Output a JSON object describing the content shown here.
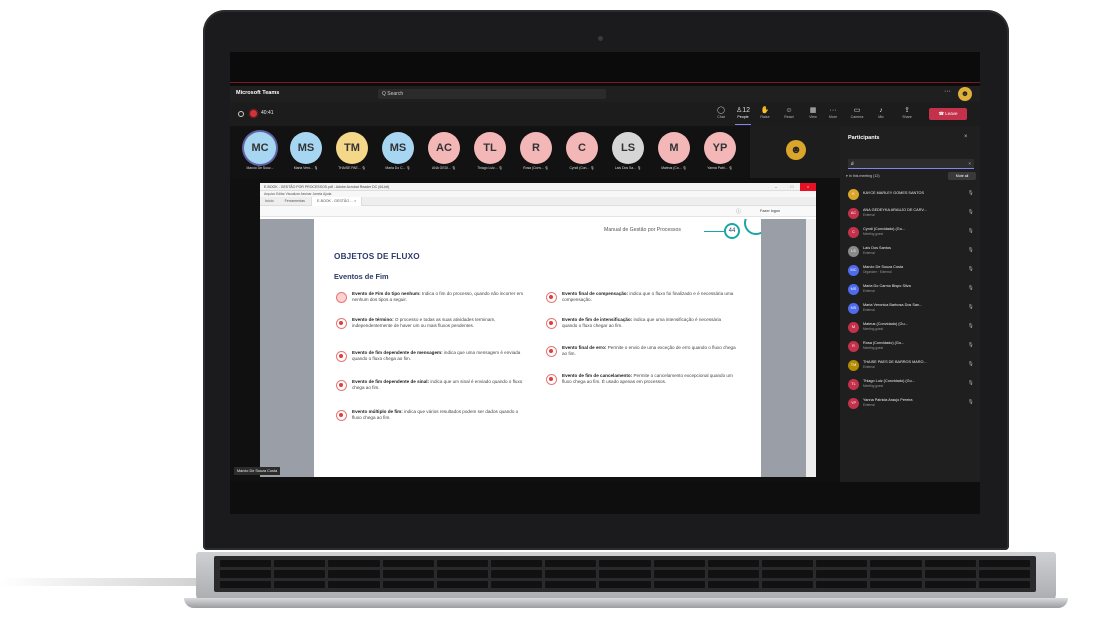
{
  "app": {
    "name": "Microsoft Teams",
    "search_placeholder": "Q Search",
    "more": "···"
  },
  "meeting": {
    "timer": "40:41"
  },
  "toolbar": [
    {
      "icon": "chat-icon",
      "glyph": "◯",
      "label": "Chat"
    },
    {
      "icon": "people-icon",
      "glyph": "♙12",
      "label": "People"
    },
    {
      "icon": "raise-hand-icon",
      "glyph": "✋",
      "label": "Raise"
    },
    {
      "icon": "react-icon",
      "glyph": "☺",
      "label": "React"
    },
    {
      "icon": "view-icon",
      "glyph": "▦",
      "label": "View"
    },
    {
      "icon": "more-icon",
      "glyph": "···",
      "label": "More"
    }
  ],
  "right_toolbar": [
    {
      "icon": "camera-icon",
      "glyph": "▭",
      "label": "Camera"
    },
    {
      "icon": "mic-icon",
      "glyph": "♪",
      "label": "Mic"
    },
    {
      "icon": "share-icon",
      "glyph": "⇪",
      "label": "Share"
    }
  ],
  "leave_label": "☎ Leave",
  "avatars": [
    {
      "initials": "MC",
      "name": "Marcio De Souz...",
      "color": "#a7d6f2"
    },
    {
      "initials": "MS",
      "name": "Maria Vero... 🎙",
      "color": "#a7d6f2"
    },
    {
      "initials": "TM",
      "name": "THAISE PAE... 🎙",
      "color": "#f5d78a"
    },
    {
      "initials": "MS",
      "name": "Maria Do C... 🎙",
      "color": "#a7d6f2"
    },
    {
      "initials": "AC",
      "name": "ANA GEDI... 🎙",
      "color": "#f4b7b7"
    },
    {
      "initials": "TL",
      "name": "Thiago Luiz... 🎙",
      "color": "#f4b7b7"
    },
    {
      "initials": "R",
      "name": "Rosa (Conv... 🎙",
      "color": "#f4b7b7"
    },
    {
      "initials": "C",
      "name": "Cyndi (Con... 🎙",
      "color": "#f4b7b7"
    },
    {
      "initials": "LS",
      "name": "Laís Dos Sa... 🎙",
      "color": "#d6d6d6"
    },
    {
      "initials": "M",
      "name": "Mateus (Co... 🎙",
      "color": "#f4b7b7"
    },
    {
      "initials": "YP",
      "name": "Yanna Patri... 🎙",
      "color": "#f4b7b7"
    }
  ],
  "presenter_tag": "Marcio De Souza Costa",
  "acrobat": {
    "title": "E-BOOK - GESTÃO POR PROCESSOS.pdf - Adobe Acrobat Reader DC (64-bit)",
    "menu": "Arquivo  Editar  Visualizar  Assinar  Janela  Ajuda",
    "tabs": [
      "Início",
      "Ferramentas",
      "E-BOOK - GESTÃO ...  ×"
    ],
    "sign_in": "Fazer logon"
  },
  "pdf": {
    "header": "Manual de Gestão por Processos",
    "page_number": "44",
    "h1": "OBJETOS DE FLUXO",
    "h2": "Eventos de Fim",
    "left_events": [
      {
        "title": "Evento de Fim do tipo nenhum:",
        "text": " Indica o fim do processo, quando não incorrer em nenhum dos tipos a seguir.",
        "style": "plain"
      },
      {
        "title": "Evento de término:",
        "text": " O processo e todas as suas atividades terminam, independentemente de haver um ou mais fluxos pendentes.",
        "style": "solid"
      },
      {
        "title": "Evento de fim dependente de mensagem:",
        "text": " indica que uma mensagem é enviada quando o fluxo chega ao fim.",
        "style": "solid"
      },
      {
        "title": "Evento de fim dependente de sinal:",
        "text": " indica que um sinal é enviado quando o fluxo chega ao fim.",
        "style": "solid"
      },
      {
        "title": "Evento múltiplo de fim:",
        "text": " indica que vários resultados podem ser dados quando o fluxo chega ao fim.",
        "style": "solid"
      }
    ],
    "right_events": [
      {
        "title": "Evento final de compensação:",
        "text": " indica que o fluxo foi finalizado e é necessária uma compensação.",
        "style": "solid"
      },
      {
        "title": "Evento de fim de intensificação:",
        "text": " indica que uma intensificação é necessária quando o fluxo chegar ao fim.",
        "style": "solid"
      },
      {
        "title": "Evento final de erro:",
        "text": " Permite o envio de uma exceção de erro quando o fluxo chega ao fim.",
        "style": "solid"
      },
      {
        "title": "Evento de fim de cancelamento:",
        "text": " Permite o cancelamento excepcional quando um fluxo chega ao fim. É usado apenas em processos.",
        "style": "solid"
      }
    ]
  },
  "participants": {
    "title": "Participants",
    "search_value": "d",
    "in_meeting": "▾ In this meeting (12)",
    "mute_all": "Mute all",
    "list": [
      {
        "initials": "K",
        "name": "KAYCE MARLEY GOMES SANTOS",
        "role": "",
        "color": "#d9a52b"
      },
      {
        "initials": "AC",
        "name": "ANA GEDEYKA ARAUJO DE CARV...",
        "role": "External",
        "color": "#c4314b"
      },
      {
        "initials": "C",
        "name": "Cyndi (Convidado) (Gu...",
        "role": "Meeting guest",
        "color": "#c4314b"
      },
      {
        "initials": "LS",
        "name": "Laís Dos Santos",
        "role": "External",
        "color": "#8a8a8a"
      },
      {
        "initials": "MC",
        "name": "Marcio De Souza Costa",
        "role": "Organizer · External",
        "color": "#4f6bed"
      },
      {
        "initials": "MS",
        "name": "Maria Do Carmo Bispo Silva",
        "role": "External",
        "color": "#4f6bed"
      },
      {
        "initials": "MS",
        "name": "Maria Veronica Barbosa Dos San...",
        "role": "External",
        "color": "#4f6bed"
      },
      {
        "initials": "M",
        "name": "Mateus (Convidado) (Gu...",
        "role": "Meeting guest",
        "color": "#c4314b"
      },
      {
        "initials": "R",
        "name": "Rosa (Convidado) (Gu...",
        "role": "Meeting guest",
        "color": "#c4314b"
      },
      {
        "initials": "TM",
        "name": "THAISE PAES DE BARROS MARO...",
        "role": "External",
        "color": "#b38b00"
      },
      {
        "initials": "TL",
        "name": "Thiago Luiz (Convidado) (Gu...",
        "role": "Meeting guest",
        "color": "#c4314b"
      },
      {
        "initials": "YP",
        "name": "Yanna Patricia Araujo Pereira",
        "role": "External",
        "color": "#c4314b"
      }
    ]
  }
}
